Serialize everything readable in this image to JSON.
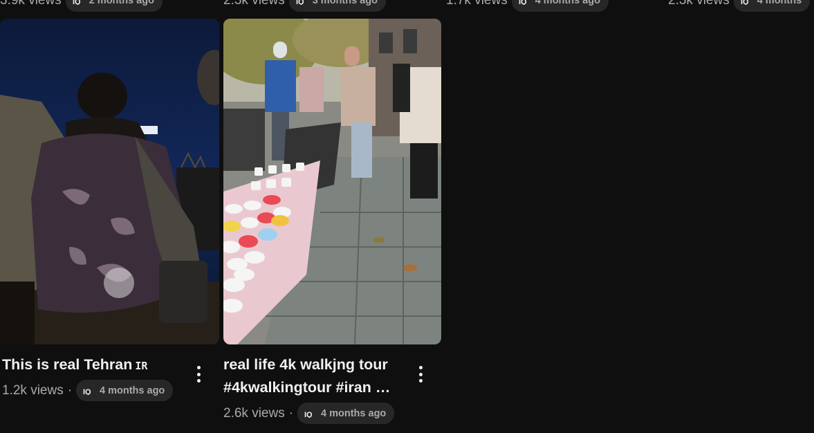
{
  "top_row": [
    {
      "views": "3.9k views",
      "age": "2 months ago"
    },
    {
      "views": "2.3k views",
      "age": "3 months ago"
    },
    {
      "views": "1.7k views",
      "age": "4 months ago"
    },
    {
      "views": "2.3k views",
      "age": "4 months"
    }
  ],
  "videos": [
    {
      "title": "This is real Tehran",
      "flag": "IR",
      "views": "1.2k views",
      "separator": "·",
      "age": "4 months ago"
    },
    {
      "title_line1": "real life 4k walkjng tour",
      "title_line2": "#4kwalkingtour #iran …",
      "views": "2.6k views",
      "separator": "·",
      "age": "4 months ago"
    }
  ],
  "icons": {
    "age_badge": "iq-logo-icon",
    "menu": "more-vert-icon"
  },
  "colors": {
    "background": "#0f0f0f",
    "title_text": "#f1f1f1",
    "meta_text": "#aaaaaa",
    "pill_bg": "#272727"
  }
}
